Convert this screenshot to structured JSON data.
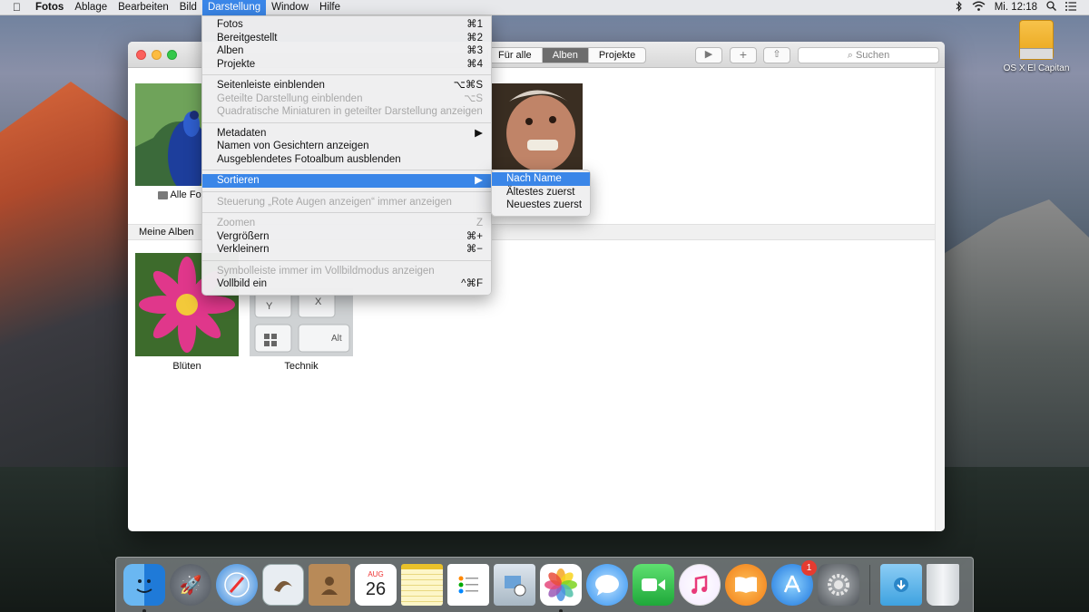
{
  "menubar": {
    "apple": "",
    "items": [
      "Fotos",
      "Ablage",
      "Bearbeiten",
      "Bild",
      "Darstellung",
      "Window",
      "Hilfe"
    ],
    "clock": "Mi. 12:18"
  },
  "desktop": {
    "drive_label": "OS X El Capitan"
  },
  "window": {
    "segments": [
      "Für alle",
      "Alben",
      "Projekte"
    ],
    "search_placeholder": "Suchen",
    "album_top_label": "Alle Fot",
    "section_title": "Meine Alben",
    "albums": [
      "Blüten",
      "Technik"
    ],
    "keyboard_keys": [
      "Y",
      "X",
      "Alt"
    ]
  },
  "menu_darstellung": [
    {
      "label": "Fotos",
      "shortcut": "⌘1",
      "disabled": false
    },
    {
      "label": "Bereitgestellt",
      "shortcut": "⌘2",
      "disabled": false
    },
    {
      "label": "Alben",
      "shortcut": "⌘3",
      "disabled": false
    },
    {
      "label": "Projekte",
      "shortcut": "⌘4",
      "disabled": false
    },
    {
      "sep": true
    },
    {
      "label": "Seitenleiste einblenden",
      "shortcut": "⌥⌘S",
      "disabled": false
    },
    {
      "label": "Geteilte Darstellung einblenden",
      "shortcut": "⌥S",
      "disabled": true
    },
    {
      "label": "Quadratische Miniaturen in geteilter Darstellung anzeigen",
      "shortcut": "",
      "disabled": true
    },
    {
      "sep": true
    },
    {
      "label": "Metadaten",
      "shortcut": "▶",
      "disabled": false
    },
    {
      "label": "Namen von Gesichtern anzeigen",
      "shortcut": "",
      "disabled": false
    },
    {
      "label": "Ausgeblendetes Fotoalbum ausblenden",
      "shortcut": "",
      "disabled": false
    },
    {
      "sep": true
    },
    {
      "label": "Sortieren",
      "shortcut": "▶",
      "disabled": false,
      "highlighted": true
    },
    {
      "sep": true
    },
    {
      "label": "Steuerung „Rote Augen anzeigen“ immer anzeigen",
      "shortcut": "",
      "disabled": true
    },
    {
      "sep": true
    },
    {
      "label": "Zoomen",
      "shortcut": "Z",
      "disabled": true
    },
    {
      "label": "Vergrößern",
      "shortcut": "⌘+",
      "disabled": false
    },
    {
      "label": "Verkleinern",
      "shortcut": "⌘−",
      "disabled": false
    },
    {
      "sep": true
    },
    {
      "label": "Symbolleiste immer im Vollbildmodus anzeigen",
      "shortcut": "",
      "disabled": true
    },
    {
      "label": "Vollbild ein",
      "shortcut": "^⌘F",
      "disabled": false
    }
  ],
  "menu_sortieren": [
    {
      "label": "Nach Name",
      "highlighted": true
    },
    {
      "label": "Ältestes zuerst",
      "highlighted": false
    },
    {
      "label": "Neuestes zuerst",
      "highlighted": false
    }
  ],
  "calendar": {
    "month": "AUG",
    "day": "26"
  },
  "appstore_badge": "1",
  "dock_icons": [
    "finder-icon",
    "launchpad-icon",
    "safari-icon",
    "mail-icon",
    "contacts-icon",
    "calendar-icon",
    "notes-icon",
    "reminders-icon",
    "preview-icon",
    "photos-icon",
    "messages-icon",
    "facetime-icon",
    "itunes-icon",
    "ibooks-icon",
    "appstore-icon",
    "system-preferences-icon",
    "downloads-folder-icon",
    "trash-icon"
  ]
}
